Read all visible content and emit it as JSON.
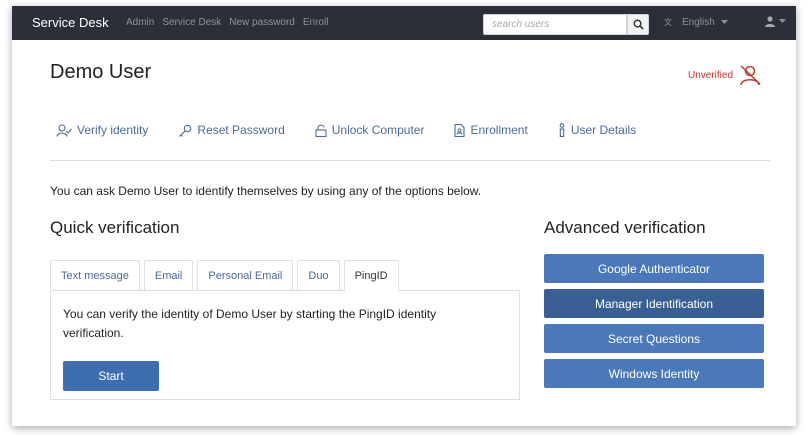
{
  "navbar": {
    "brand": "Service Desk",
    "links": [
      "Admin",
      "Service Desk",
      "New password",
      "Enroll"
    ],
    "search_placeholder": "search users",
    "language": "English"
  },
  "header": {
    "title": "Demo User",
    "status": "Unverified"
  },
  "action_tabs": [
    {
      "label": "Verify identity",
      "icon": "user-check-icon"
    },
    {
      "label": "Reset Password",
      "icon": "key-icon"
    },
    {
      "label": "Unlock Computer",
      "icon": "unlock-icon"
    },
    {
      "label": "Enrollment",
      "icon": "document-icon"
    },
    {
      "label": "User Details",
      "icon": "info-icon"
    }
  ],
  "intro_text": "You can ask Demo User to identify themselves by using any of the options below.",
  "quick": {
    "heading": "Quick verification",
    "tabs": [
      "Text message",
      "Email",
      "Personal Email",
      "Duo",
      "PingID"
    ],
    "active_tab": "PingID",
    "panel_text": "You can verify the identity of Demo User by starting the PingID identity verification.",
    "start_label": "Start"
  },
  "advanced": {
    "heading": "Advanced verification",
    "options": [
      "Google Authenticator",
      "Manager Identification",
      "Secret Questions",
      "Windows Identity"
    ],
    "active_option": "Manager Identification"
  },
  "colors": {
    "navbar": "#2b2f38",
    "accent": "#4a78b8",
    "link": "#4a6a96",
    "unverified": "#c0392b"
  }
}
